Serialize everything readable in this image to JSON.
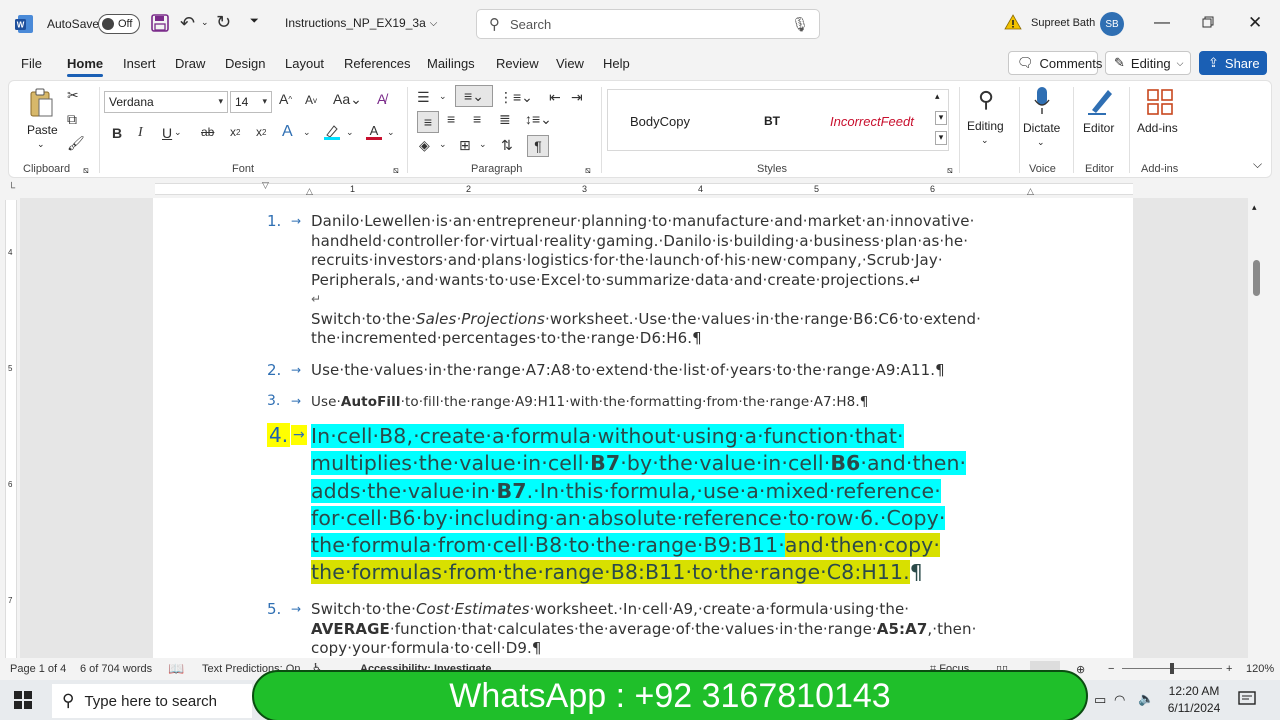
{
  "titlebar": {
    "autosave_label": "AutoSave",
    "autosave_state": "Off",
    "doc_title": "Instructions_NP_EX19_3a",
    "search_placeholder": "Search",
    "user_name": "Supreet Bath",
    "user_initials": "SB"
  },
  "tabs": [
    "File",
    "Home",
    "Insert",
    "Draw",
    "Design",
    "Layout",
    "References",
    "Mailings",
    "Review",
    "View",
    "Help"
  ],
  "tab_actions": {
    "comments": "Comments",
    "editing": "Editing",
    "share": "Share"
  },
  "ribbon": {
    "clipboard": {
      "paste": "Paste",
      "label": "Clipboard"
    },
    "font": {
      "name": "Verdana",
      "size": "14",
      "label": "Font"
    },
    "paragraph": {
      "label": "Paragraph"
    },
    "styles": {
      "items": [
        "BodyCopy",
        "BT",
        "IncorrectFeedt"
      ],
      "label": "Styles"
    },
    "editing": {
      "label": "Editing"
    },
    "voice": {
      "dictate": "Dictate",
      "label": "Voice"
    },
    "editor": {
      "button": "Editor",
      "label": "Editor"
    },
    "addins": {
      "button": "Add-ins",
      "label": "Add-ins"
    }
  },
  "ruler": {
    "h_numbers": [
      "1",
      "2",
      "3",
      "4",
      "5",
      "6"
    ],
    "v_numbers": [
      "4",
      "5",
      "6",
      "7"
    ]
  },
  "document": {
    "items": [
      {
        "num": "1.",
        "lines": [
          "Danilo·Lewellen·is·an·entrepreneur·planning·to·manufacture·and·market·an·innovative·",
          "handheld·controller·for·virtual·reality·gaming.·Danilo·is·building·a·business·plan·as·he·",
          "recruits·investors·and·plans·logistics·for·the·launch·of·his·new·company,·Scrub·Jay·",
          "Peripherals,·and·wants·to·use·Excel·to·summarize·data·and·create·projections.↵",
          "↵"
        ],
        "sub_a": "Switch·to·the·",
        "sub_ital": "Sales·Projections",
        "sub_b": "·worksheet.·Use·the·values·in·the·range·B6:C6·to·extend·",
        "sub_c": "the·incremented·percentages·to·the·range·D6:H6.¶"
      },
      {
        "num": "2.",
        "text": "Use·the·values·in·the·range·A7:A8·to·extend·the·list·of·years·to·the·range·A9:A11.¶"
      },
      {
        "num": "3.",
        "pre": "Use·",
        "bold": "AutoFill",
        "post": "·to·fill·the·range·A9:H11·with·the·formatting·from·the·range·A7:H8.¶"
      },
      {
        "num": "4.",
        "l1": "In·cell·B8,·create·a·formula·without·using·a·function·that·",
        "l2a": "multiplies·the·value·in·cell·",
        "l2b": "B7",
        "l2c": "·by·the·value·in·cell·",
        "l2d": "B6",
        "l2e": "·and·then·",
        "l3a": "adds·the·value·in·",
        "l3b": "B7",
        "l3c": ".·In·this·formula,·use·a·mixed·reference·",
        "l4": "for·cell·B6·by·including·an·absolute·reference·to·row·6.·Copy·",
        "l5a": "the·formula·from·cell·B8·to·the·range·B9:B11·",
        "l5b": "and·then·copy·",
        "l6": "the·formulas·from·the·range·B8:B11·to·the·range·C8:H11.",
        "l6end": "¶"
      },
      {
        "num": "5.",
        "a": "Switch·to·the·",
        "ital": "Cost·Estimates",
        "b": "·worksheet.·In·cell·A9,·create·a·formula·using·the·",
        "c_bold": "AVERAGE",
        "d": "·function·that·calculates·the·average·of·the·values·in·the·range·",
        "e_bold": "A5:A7",
        "f": ",·then·",
        "g": "copy·your·formula·to·cell·D9.¶"
      }
    ]
  },
  "status": {
    "page": "Page 1 of 4",
    "words": "6 of 704 words",
    "predictions": "Text Predictions: On",
    "accessibility": "Accessibility: Investigate",
    "focus": "Focus",
    "zoom": "120%"
  },
  "taskbar": {
    "search_placeholder": "Type here to search",
    "time": "12:20 AM",
    "date": "6/11/2024"
  },
  "overlay": {
    "banner": "WhatsApp : +92 3167810143"
  },
  "colors": {
    "accent": "#1a5fb4",
    "cyan_highlight": "#00ffff",
    "yellow_highlight": "#d8e000",
    "banner_green": "#1fbf2a"
  }
}
